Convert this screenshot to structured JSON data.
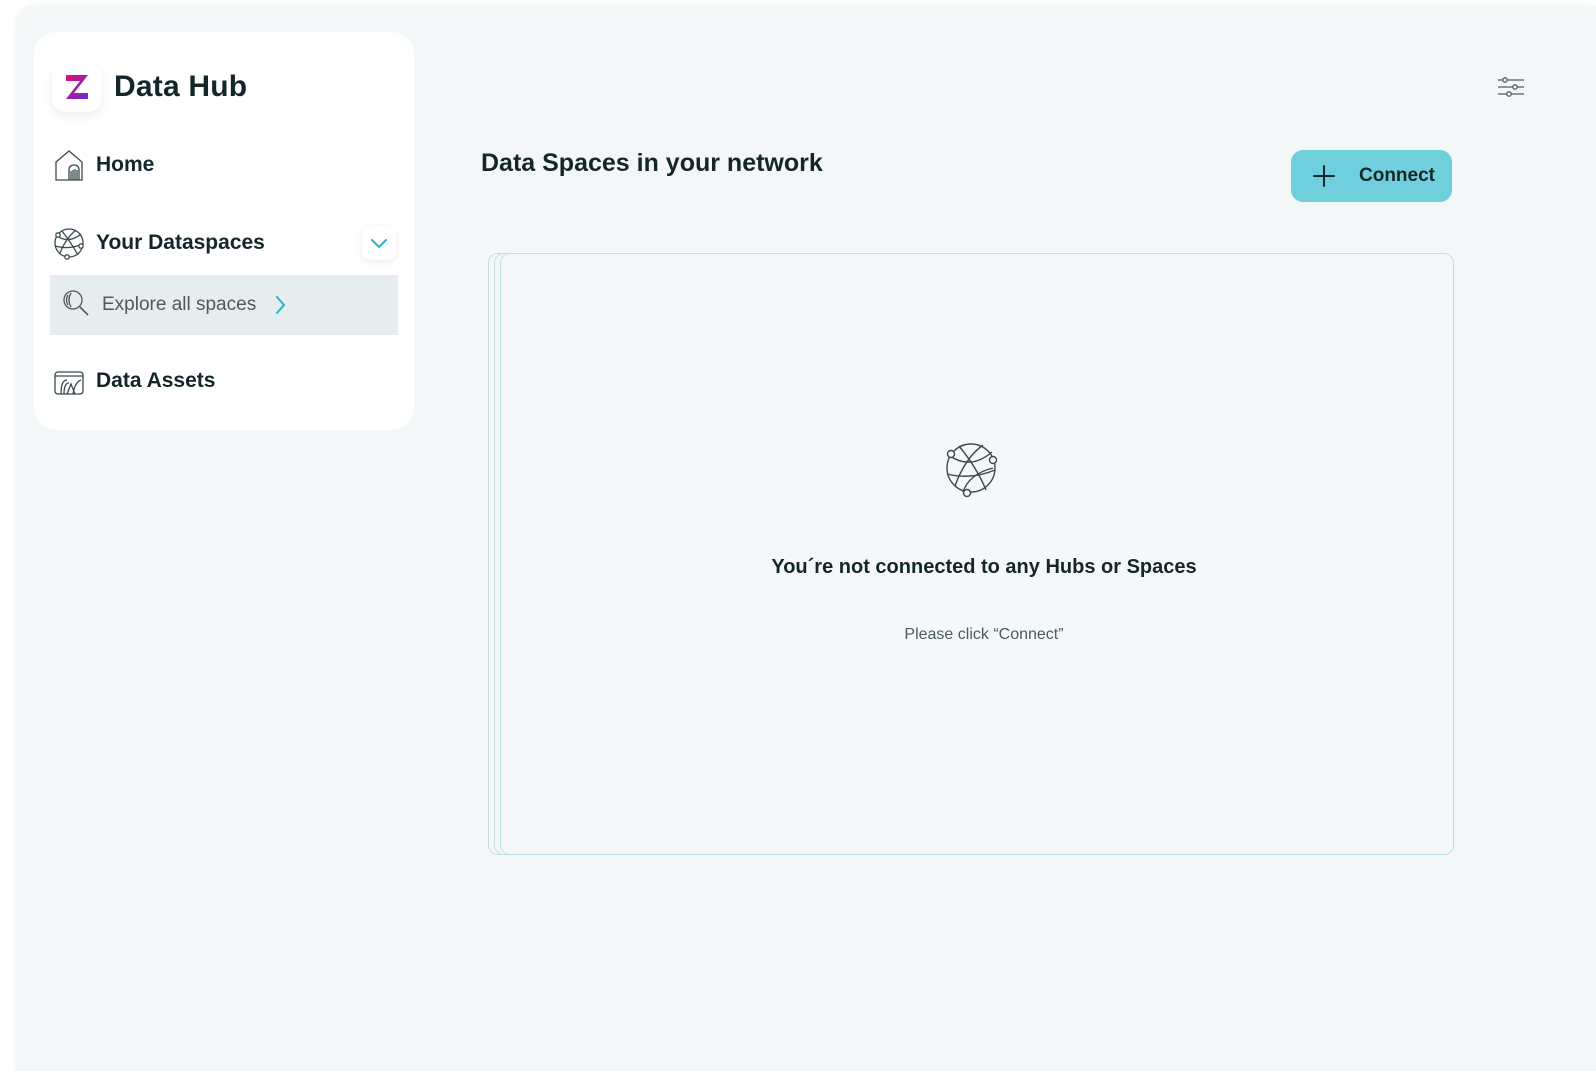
{
  "app": {
    "title": "Data Hub",
    "logo_letter": "Z"
  },
  "sidebar": {
    "items": [
      {
        "label": "Home",
        "icon": "home-icon"
      },
      {
        "label": "Your Dataspaces",
        "icon": "globe-network-icon",
        "expanded": true,
        "children": [
          {
            "label": "Explore all spaces",
            "icon": "search-icon"
          }
        ]
      },
      {
        "label": "Data Assets",
        "icon": "data-assets-icon"
      }
    ]
  },
  "main": {
    "title": "Data Spaces in your network",
    "connect_label": "Connect",
    "empty_state": {
      "title": "You´re not connected to any Hubs or Spaces",
      "subtitle": "Please click “Connect”"
    }
  },
  "colors": {
    "accent": "#6fcfdc",
    "chevron": "#2ab3c6",
    "text": "#13272b",
    "logo_gradient": [
      "#e0126e",
      "#6a2ad8"
    ]
  }
}
